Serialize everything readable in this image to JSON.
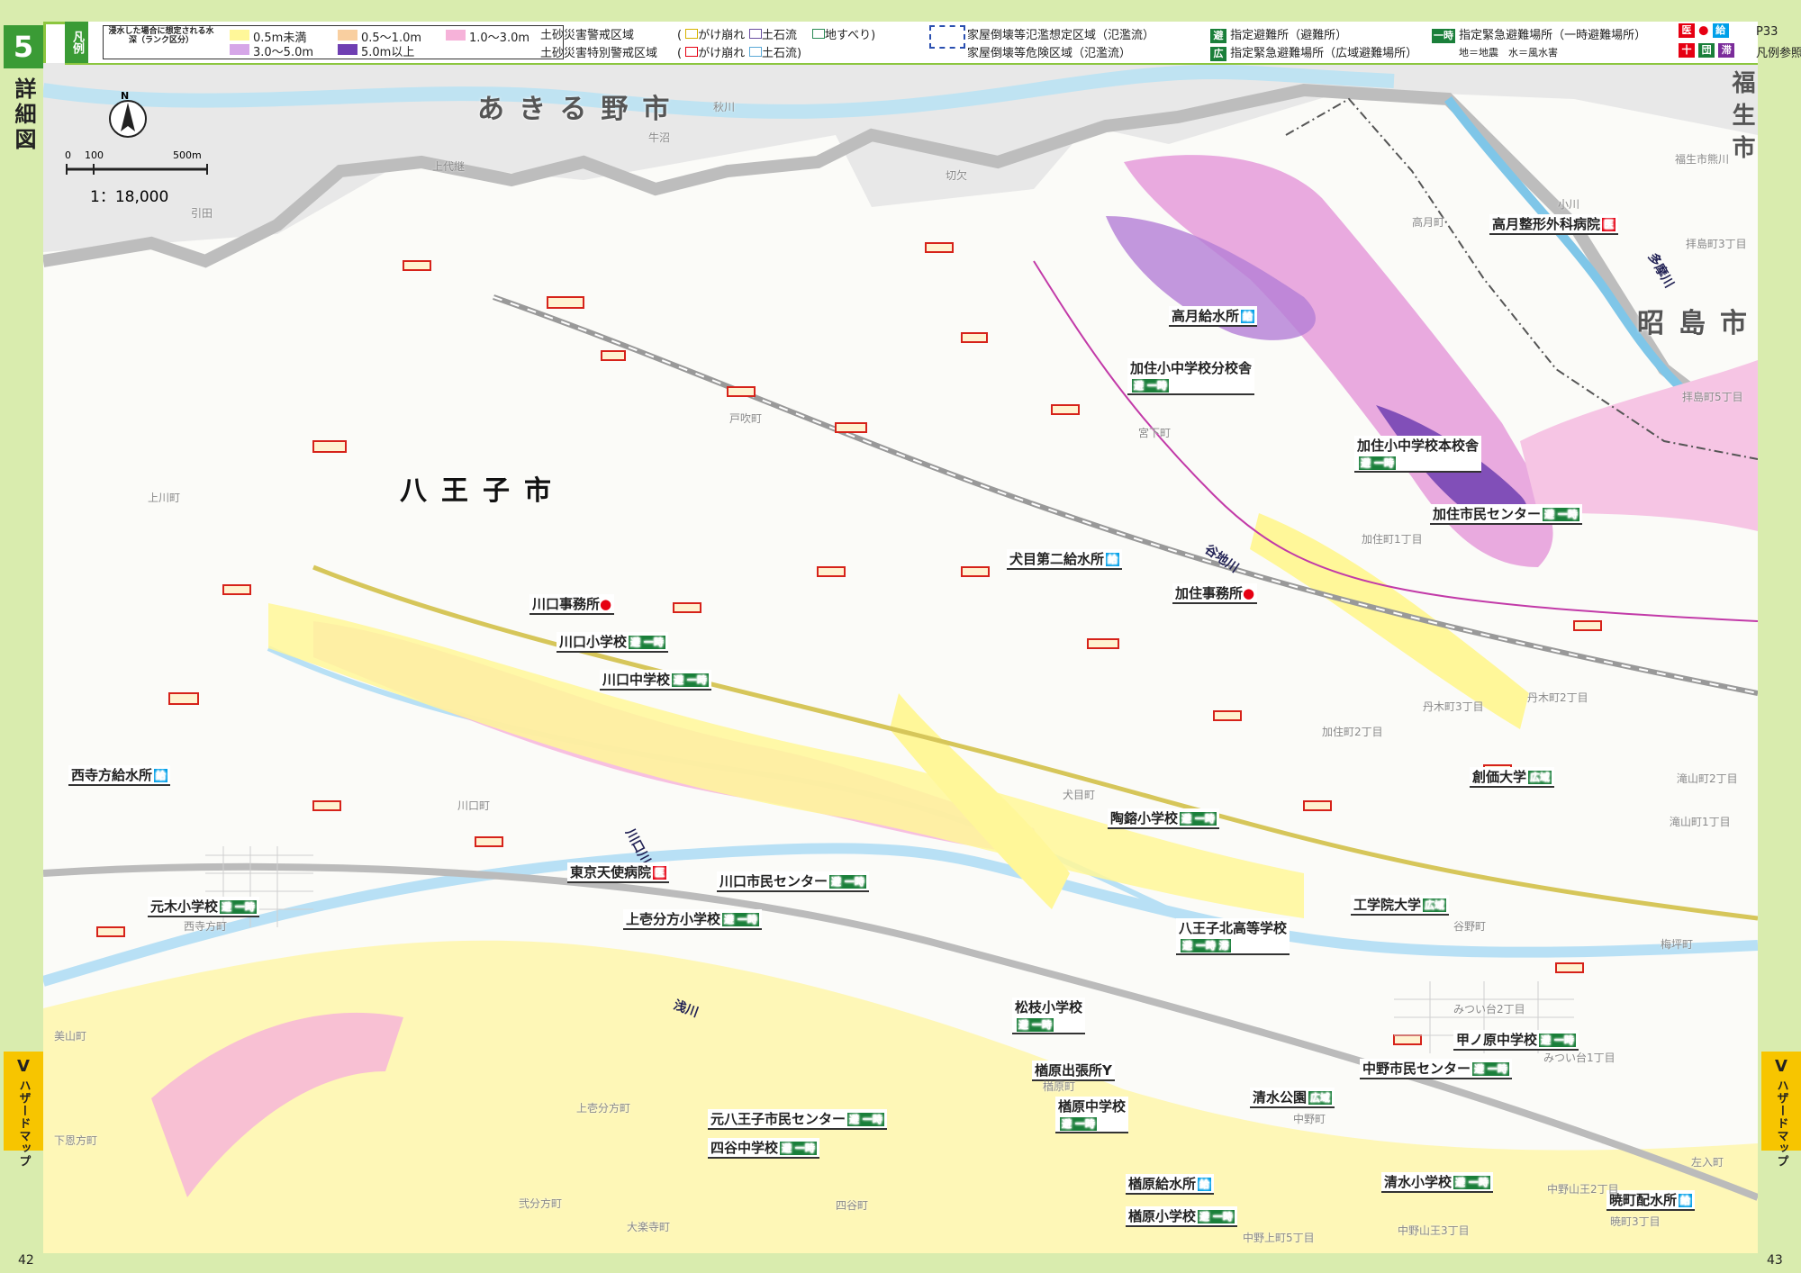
{
  "page": {
    "section_number": "5",
    "section_title": "詳細図",
    "page_left": "42",
    "page_right": "43",
    "side_tab": {
      "letter": "V",
      "text": "ハザードマップ"
    }
  },
  "legend": {
    "tag": "凡例",
    "depth_header": "浸水した場合に想定される水深（ランク区分）",
    "depth_classes": [
      {
        "label": "0.5m未満",
        "color": "#fff799"
      },
      {
        "label": "0.5～1.0m",
        "color": "#f9cfa0"
      },
      {
        "label": "1.0～3.0m",
        "color": "#f6b2d9"
      },
      {
        "label": "3.0～5.0m",
        "color": "#d6a6e8"
      },
      {
        "label": "5.0m以上",
        "color": "#6f3fb2"
      }
    ],
    "sediment_warning": "土砂災害警戒区域",
    "sediment_special": "土砂災害特別警戒区域",
    "cliff_collapse": "がけ崩れ",
    "debris_flow": "土石流",
    "landslide": "地すべり",
    "house_collapse_assumed": "家屋倒壊等氾濫想定区域（氾濫流）",
    "house_collapse_danger": "家屋倒壊等危険区域（氾濫流）",
    "evac_site": "指定避難所（避難所）",
    "emergency_evac_temp": "指定緊急避難場所（一時避難場所）",
    "emergency_evac_wide": "指定緊急避難場所（広域避難場所）",
    "icon_note": "地＝地震　水＝風水害",
    "ref_page": "P33",
    "ref_text": "凡例参照",
    "colors": {
      "hospital": "#e60012",
      "water": "#00a0e9",
      "stay": "#7b2c9a",
      "green": "#1a7f3a"
    }
  },
  "map": {
    "scale_ratio": "1：18,000",
    "scale_ticks": [
      "0",
      "100",
      "500m"
    ],
    "north": "N",
    "cities": {
      "akiruno": "あきる野市",
      "hachioji": "八王子市",
      "akishima": "昭島市",
      "fussa": "福生市"
    },
    "rivers": {
      "tama": "多摩川",
      "kawaguchi": "川口川",
      "asa": "浅川",
      "yachi": "谷地川"
    },
    "facilities": [
      {
        "name": "高月整形外科病院",
        "tag": "医"
      },
      {
        "name": "高月給水所",
        "tag": "給"
      },
      {
        "name": "加住小中学校分校舎",
        "tag": "避 一時"
      },
      {
        "name": "加住小中学校本校舎",
        "tag": "避 一時"
      },
      {
        "name": "加住市民センター",
        "tag": "避 一時"
      },
      {
        "name": "犬目第二給水所",
        "tag": "給"
      },
      {
        "name": "加住事務所",
        "tag": "●"
      },
      {
        "name": "川口事務所",
        "tag": "●"
      },
      {
        "name": "川口小学校",
        "tag": "避 一時"
      },
      {
        "name": "川口中学校",
        "tag": "避 一時"
      },
      {
        "name": "西寺方給水所",
        "tag": "給"
      },
      {
        "name": "創価大学",
        "tag": "広域"
      },
      {
        "name": "陶鎔小学校",
        "tag": "避 一時"
      },
      {
        "name": "元木小学校",
        "tag": "避 一時"
      },
      {
        "name": "東京天使病院",
        "tag": "医"
      },
      {
        "name": "川口市民センター",
        "tag": "避 一時"
      },
      {
        "name": "上壱分方小学校",
        "tag": "避 一時"
      },
      {
        "name": "八王子北高等学校",
        "tag": "避 一時 滞"
      },
      {
        "name": "工学院大学",
        "tag": "広域"
      },
      {
        "name": "松枝小学校",
        "tag": "避 一時"
      },
      {
        "name": "甲ノ原中学校",
        "tag": "避 一時"
      },
      {
        "name": "楢原出張所",
        "tag": "Y"
      },
      {
        "name": "中野市民センター",
        "tag": "避 一時"
      },
      {
        "name": "楢原中学校",
        "tag": "避 一時"
      },
      {
        "name": "清水公園",
        "tag": "広域"
      },
      {
        "name": "元八王子市民センター",
        "tag": "避 一時"
      },
      {
        "name": "四谷中学校",
        "tag": "避 一時"
      },
      {
        "name": "楢原給水所",
        "tag": "給"
      },
      {
        "name": "清水小学校",
        "tag": "避 一時"
      },
      {
        "name": "暁町配水所",
        "tag": "給"
      },
      {
        "name": "楢原小学校",
        "tag": "避 一時"
      }
    ],
    "areas": [
      "秋川",
      "牛沼",
      "上代継",
      "切欠",
      "引田",
      "高月町",
      "小川",
      "戸吹町",
      "宮下町",
      "上川町",
      "加住町1丁目",
      "加住町2丁目",
      "丹木町2丁目",
      "丹木町3丁目",
      "犬目町",
      "川口町",
      "西寺方町",
      "谷野町",
      "梅坪町",
      "滝山町2丁目",
      "滝山町1丁目",
      "みつい台2丁目",
      "みつい台1丁目",
      "上壱分方町",
      "楢原町",
      "中野町",
      "中野山王2丁目",
      "中野山王3丁目",
      "暁町3丁目",
      "中野上町5丁目",
      "四谷町",
      "弐分方町",
      "大楽寺町",
      "下恩方町",
      "左入町",
      "美山町",
      "拝島町3丁目",
      "拝島町5丁目",
      "福生市熊川"
    ]
  }
}
